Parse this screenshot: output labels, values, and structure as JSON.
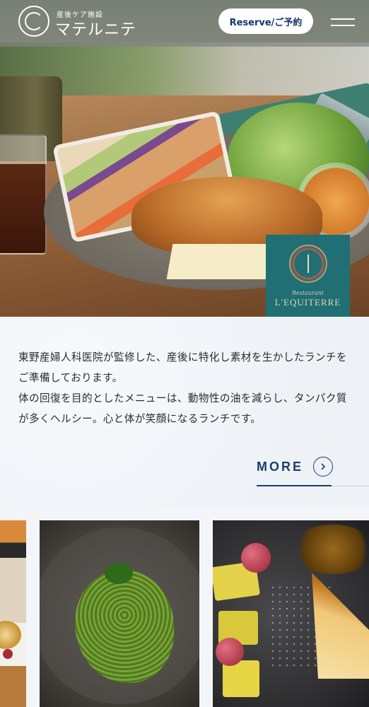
{
  "header": {
    "logo_subtitle": "産後ケア施設",
    "logo_name": "マテルニテ",
    "reserve_label": "Reserve/ご予約",
    "menu_icon": "hamburger-icon"
  },
  "hero": {
    "brand_tile": {
      "script_text": "Restaurant",
      "name": "L'EQUITERRE",
      "emblem_icon": "tree-emblem-icon"
    },
    "background_color": "#1f6f74"
  },
  "intro": {
    "paragraph_1": "東野産婦人科医院が監修した、産後に特化し素材を生かしたランチをご準備しております。",
    "paragraph_2": "体の回復を目的としたメニューは、動物性の油を減らし、タンパク質が多くヘルシー。心と体が笑顔になるランチです。",
    "more_label": "MORE",
    "more_icon": "chevron-right-circle-icon",
    "accent_color": "#1a3f6b"
  },
  "gallery": {
    "tiles": [
      {
        "name": "dessert-tart-photo"
      },
      {
        "name": "genovese-pasta-photo"
      },
      {
        "name": "fruit-and-pie-photo"
      }
    ]
  }
}
